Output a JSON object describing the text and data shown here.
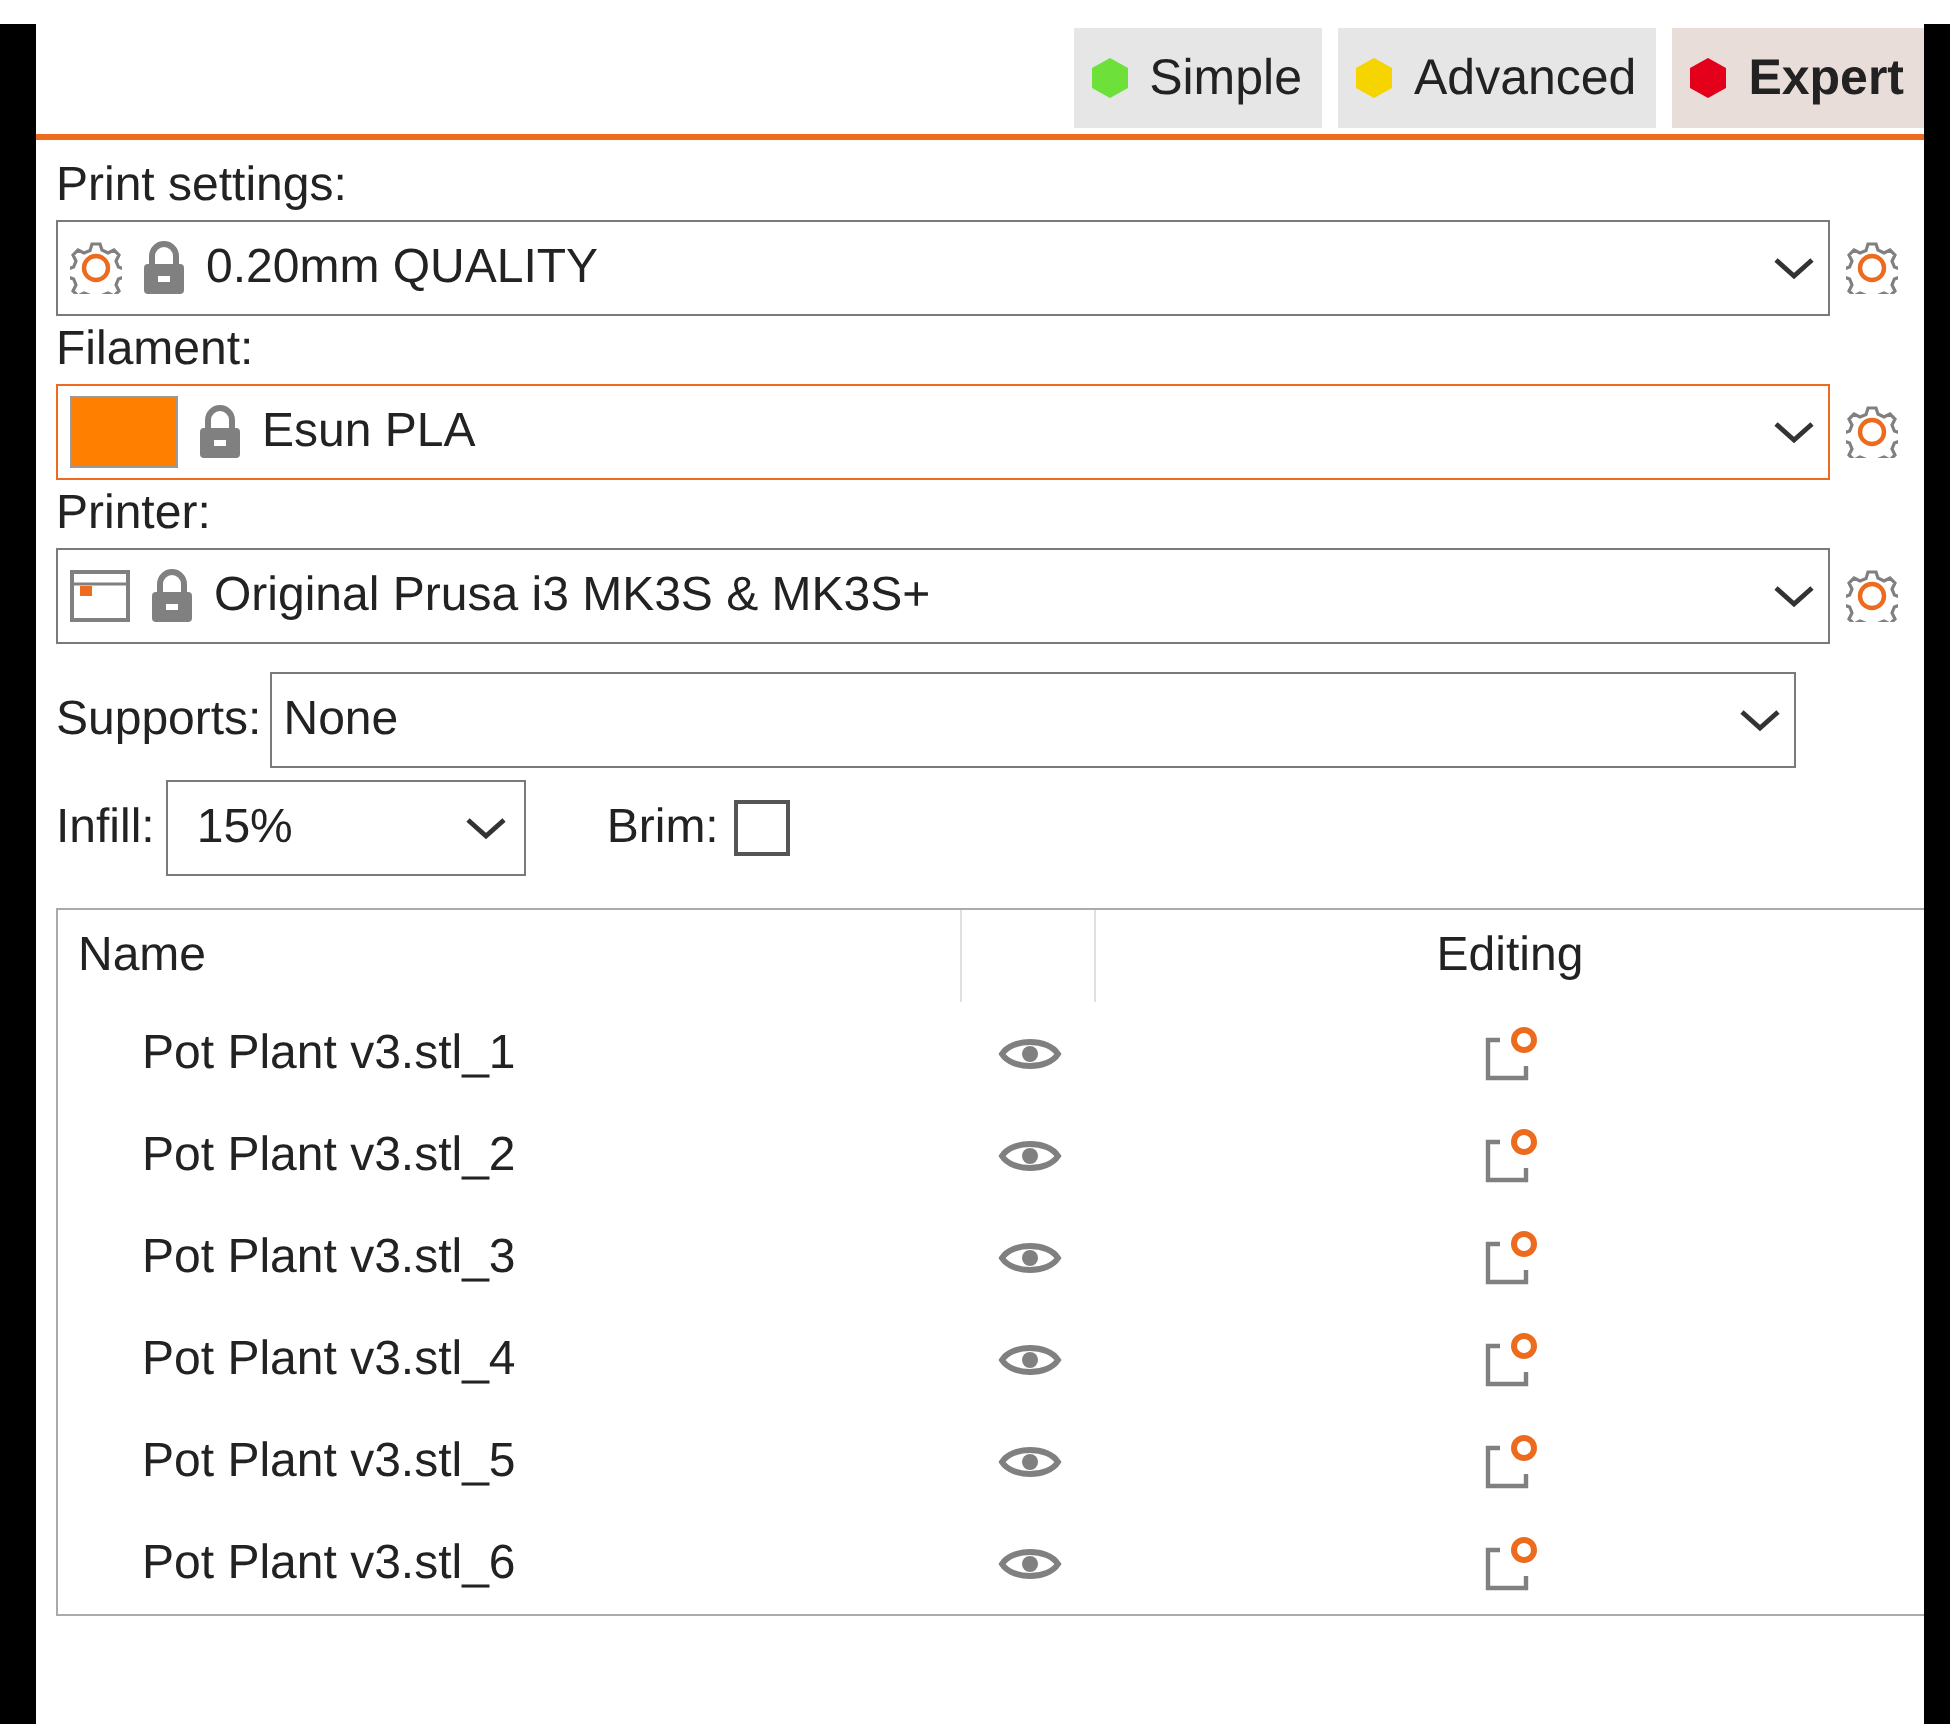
{
  "modes": [
    {
      "label": "Simple",
      "color": "#6ee03a",
      "selected": false
    },
    {
      "label": "Advanced",
      "color": "#f5d400",
      "selected": false
    },
    {
      "label": "Expert",
      "color": "#e4001b",
      "selected": true
    }
  ],
  "presets": [
    {
      "label": "Print settings:",
      "value": "0.20mm QUALITY",
      "kind": "print",
      "focused": false
    },
    {
      "label": "Filament:",
      "value": "Esun PLA",
      "kind": "filament",
      "color": "#ff8000",
      "focused": true
    },
    {
      "label": "Printer:",
      "value": "Original Prusa i3 MK3S & MK3S+",
      "kind": "printer",
      "focused": false
    }
  ],
  "supports": {
    "label": "Supports:",
    "value": "None"
  },
  "infill": {
    "label": "Infill:",
    "value": "15%"
  },
  "brim": {
    "label": "Brim:",
    "checked": false
  },
  "table": {
    "columns": [
      "Name",
      "Editing"
    ],
    "rows": [
      {
        "name": "Pot Plant v3.stl_1"
      },
      {
        "name": "Pot Plant v3.stl_2"
      },
      {
        "name": "Pot Plant v3.stl_3"
      },
      {
        "name": "Pot Plant v3.stl_4"
      },
      {
        "name": "Pot Plant v3.stl_5"
      },
      {
        "name": "Pot Plant v3.stl_6"
      }
    ]
  }
}
